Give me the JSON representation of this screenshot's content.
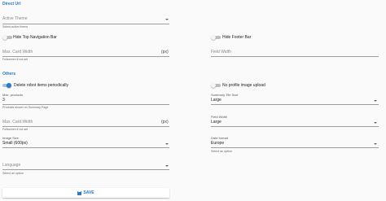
{
  "sections": {
    "direct_url": "Direct Url",
    "others": "Others"
  },
  "active_theme": {
    "placeholder": "Active Theme",
    "helper": "Select active theme"
  },
  "switches": {
    "hide_top_nav": {
      "label": "Hide Top Navigation Bar",
      "on": false
    },
    "hide_footer": {
      "label": "Hide Footer Bar",
      "on": false
    },
    "delete_robot": {
      "label": "Delete robot items periodically",
      "on": true
    },
    "no_profile_image": {
      "label": "No profile image upload",
      "on": false
    }
  },
  "max_card_width_1": {
    "placeholder": "Max. Card Width",
    "adornment": "(px)",
    "helper": "Fullscreen if not set"
  },
  "field_width_1": {
    "placeholder": "Field Width"
  },
  "max_products": {
    "label": "Max. products",
    "value": "3",
    "helper": "Products shown on Summary Page"
  },
  "summary_tile_size": {
    "label": "Summary Tile Size",
    "value": "Large"
  },
  "max_card_width_2": {
    "placeholder": "Max. Card Width",
    "adornment": "(px)",
    "helper": "Fullscreen if not set"
  },
  "field_width_2": {
    "label": "Field Width",
    "value": "Large"
  },
  "image_size": {
    "label": "Image Size",
    "value": "Small (600px)"
  },
  "date_format": {
    "label": "Date format",
    "value": "Europe",
    "helper": "Select an option"
  },
  "language": {
    "placeholder": "Language",
    "helper": "Select an option"
  },
  "save_button": {
    "label": "SAVE",
    "icon": "save-icon"
  },
  "colors": {
    "accent": "#2a79c6",
    "switch_on_track": "#9cc3ea"
  }
}
